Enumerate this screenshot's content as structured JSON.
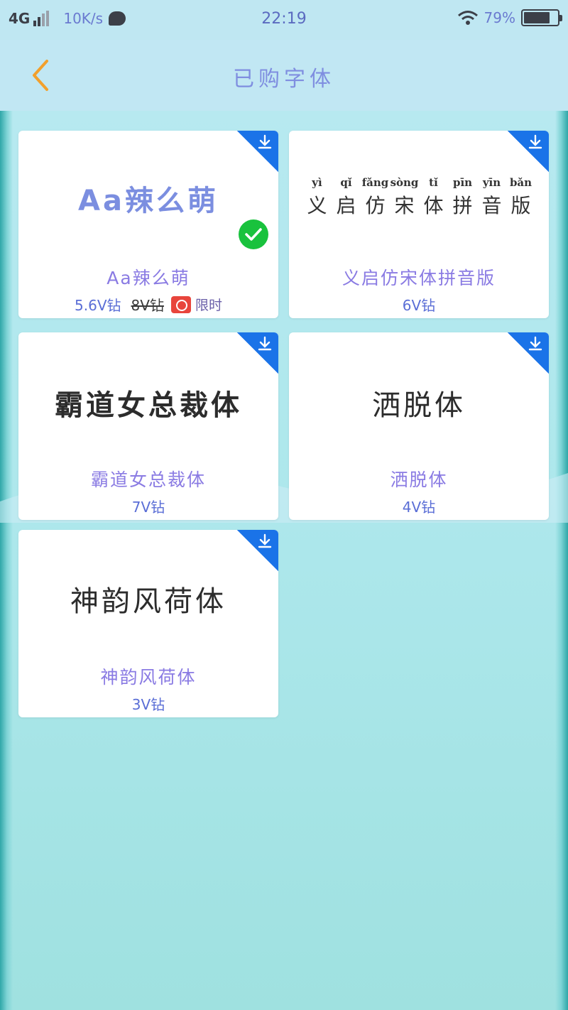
{
  "status_bar": {
    "network": "4G",
    "speed": "10K/s",
    "time": "22:19",
    "battery_percent": "79%",
    "battery_level": 0.79
  },
  "header": {
    "title": "已购字体",
    "back_icon": "chevron-left-icon",
    "accent_color": "#f2a02c"
  },
  "fonts": [
    {
      "preview": "Aa辣么萌",
      "name": "Aa辣么萌",
      "price": "5.6V钻",
      "original_price": "8V钻",
      "promo_label": "限时",
      "applied": true
    },
    {
      "preview": "义启仿宋体拼音版",
      "pinyin": [
        "yì",
        "qǐ",
        "fǎng",
        "sòng",
        "tǐ",
        "pīn",
        "yīn",
        "bǎn"
      ],
      "characters": [
        "义",
        "启",
        "仿",
        "宋",
        "体",
        "拼",
        "音",
        "版"
      ],
      "name": "义启仿宋体拼音版",
      "price": "6V钻"
    },
    {
      "preview": "霸道女总裁体",
      "name": "霸道女总裁体",
      "price": "7V钻"
    },
    {
      "preview": "洒脱体",
      "name": "洒脱体",
      "price": "4V钻"
    },
    {
      "preview": "神韵风荷体",
      "name": "神韵风荷体",
      "price": "3V钻"
    }
  ],
  "colors": {
    "download_badge": "#1a73e8",
    "applied_check": "#19c23d",
    "background": "#bfe7f2"
  }
}
